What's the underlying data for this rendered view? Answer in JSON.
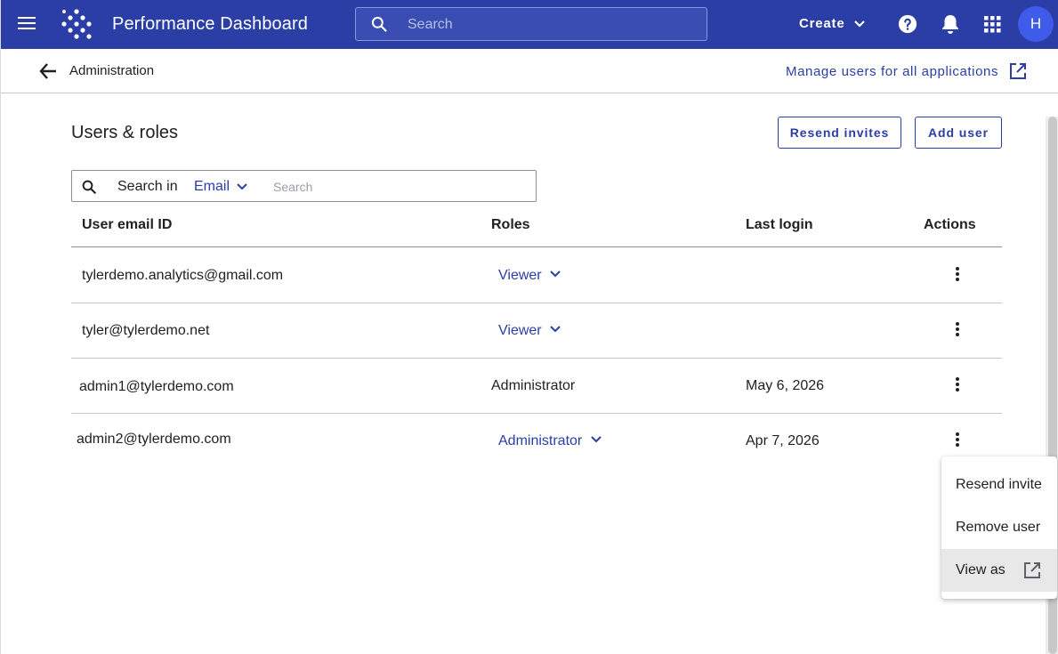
{
  "header": {
    "app_title": "Performance Dashboard",
    "search_placeholder": "Search",
    "create_label": "Create",
    "avatar_initial": "H",
    "icons": [
      "hamburger-menu-icon",
      "logo-icon",
      "search-icon",
      "chevron-down-icon",
      "help-icon",
      "bell-icon",
      "apps-grid-icon"
    ],
    "colors": {
      "bar": "#2a3ea6",
      "avatar": "#3f5bea"
    }
  },
  "subheader": {
    "breadcrumb": "Administration",
    "manage_link": "Manage users for all applications"
  },
  "page": {
    "title": "Users & roles",
    "resend_invites": "Resend invites",
    "add_user": "Add user"
  },
  "search": {
    "label": "Search in",
    "field": "Email",
    "placeholder": "Search"
  },
  "table": {
    "columns": [
      "User email ID",
      "Roles",
      "Last login",
      "Actions"
    ],
    "rows": [
      {
        "email": "tylerdemo.analytics@gmail.com",
        "role": "Viewer",
        "role_editable": true,
        "last_login": ""
      },
      {
        "email": "tyler@tylerdemo.net",
        "role": "Viewer",
        "role_editable": true,
        "last_login": ""
      },
      {
        "email": "admin1@tylerdemo.com",
        "role": "Administrator",
        "role_editable": false,
        "last_login": "May 6, 2026"
      },
      {
        "email": "admin2@tylerdemo.com",
        "role": "Administrator",
        "role_editable": true,
        "last_login": "Apr 7, 2026"
      }
    ]
  },
  "actions_menu": {
    "items": [
      "Resend invite",
      "Remove user",
      "View as"
    ],
    "highlighted": "View as"
  }
}
